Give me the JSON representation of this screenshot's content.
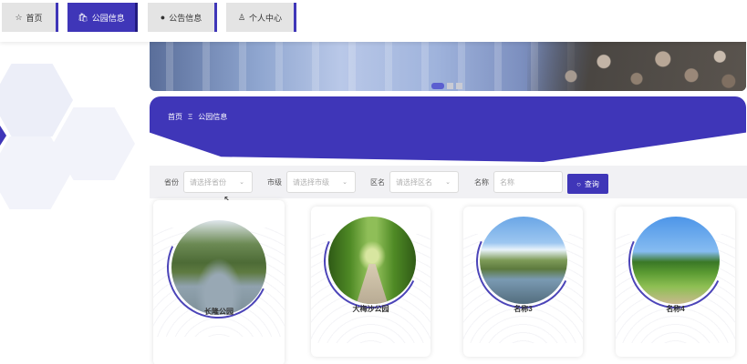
{
  "nav": {
    "tabs": [
      {
        "label": "首页",
        "icon": "star-icon",
        "active": false
      },
      {
        "label": "公园信息",
        "icon": "bag-icon",
        "active": true
      },
      {
        "label": "公告信息",
        "icon": "info-icon",
        "active": false
      },
      {
        "label": "个人中心",
        "icon": "user-icon",
        "active": false
      }
    ]
  },
  "banner": {
    "carousel_count": 3,
    "carousel_active_index": 0
  },
  "breadcrumb": {
    "home": "首页",
    "separator": "Ξ",
    "current": "公园信息"
  },
  "search": {
    "province_label": "省份",
    "province_placeholder": "请选择省份",
    "city_label": "市级",
    "city_placeholder": "请选择市级",
    "district_label": "区名",
    "district_placeholder": "请选择区名",
    "name_label": "名称",
    "name_placeholder": "名称",
    "search_button": "查询"
  },
  "parks": [
    {
      "name": "长隆公园"
    },
    {
      "name": "大梅沙公园"
    },
    {
      "name": "名称3"
    },
    {
      "name": "名称4"
    }
  ],
  "colors": {
    "accent": "#3f36b8",
    "search_bg": "#f1f1f4"
  }
}
